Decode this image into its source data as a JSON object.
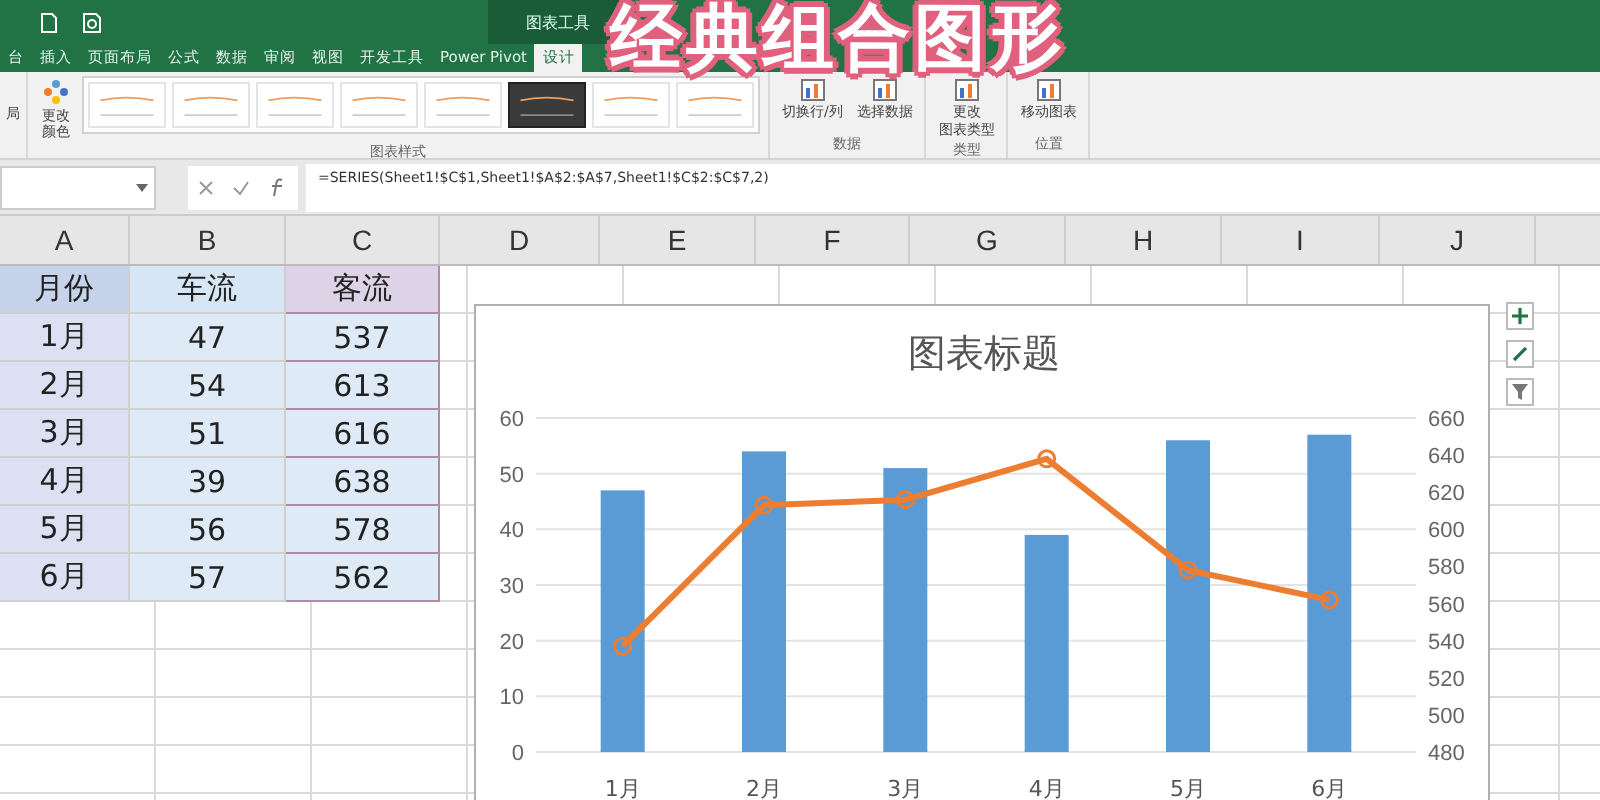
{
  "title_bar": {
    "context_label": "图表工具"
  },
  "overlay_caption": "经典组合图形",
  "tabs": [
    {
      "label": "台",
      "selected": false
    },
    {
      "label": "插入",
      "selected": false
    },
    {
      "label": "页面布局",
      "selected": false
    },
    {
      "label": "公式",
      "selected": false
    },
    {
      "label": "数据",
      "selected": false
    },
    {
      "label": "审阅",
      "selected": false
    },
    {
      "label": "视图",
      "selected": false
    },
    {
      "label": "开发工具",
      "selected": false
    },
    {
      "label": "Power Pivot",
      "selected": false
    },
    {
      "label": "设计",
      "selected": true
    }
  ],
  "ribbon": {
    "partial_label": "局",
    "change_colors": "更改颜色",
    "styles": [
      {
        "selected": false
      },
      {
        "selected": false
      },
      {
        "selected": false
      },
      {
        "selected": false
      },
      {
        "selected": false
      },
      {
        "selected": true
      },
      {
        "selected": false
      },
      {
        "selected": false
      }
    ],
    "styles_group": "图表样式",
    "groups": [
      {
        "label": "数据",
        "buttons": [
          {
            "lines": [
              "切换行/列"
            ]
          },
          {
            "lines": [
              "选择数据"
            ]
          }
        ]
      },
      {
        "label": "类型",
        "buttons": [
          {
            "lines": [
              "更改",
              "图表类型"
            ]
          }
        ]
      },
      {
        "label": "位置",
        "buttons": [
          {
            "lines": [
              "移动图表"
            ]
          }
        ]
      }
    ]
  },
  "formula_bar": {
    "formula": "=SERIES(Sheet1!$C$1,Sheet1!$A$2:$A$7,Sheet1!$C$2:$C$7,2)"
  },
  "columns": [
    "A",
    "B",
    "C",
    "D",
    "E",
    "F",
    "G",
    "H",
    "I",
    "J"
  ],
  "rows": [
    [
      "月份",
      "车流",
      "客流"
    ],
    [
      "1月",
      "47",
      "537"
    ],
    [
      "2月",
      "54",
      "613"
    ],
    [
      "3月",
      "51",
      "616"
    ],
    [
      "4月",
      "39",
      "638"
    ],
    [
      "5月",
      "56",
      "578"
    ],
    [
      "6月",
      "57",
      "562"
    ]
  ],
  "chart": {
    "chart_data": {
      "type": "bar",
      "title": "图表标题",
      "categories": [
        "1月",
        "2月",
        "3月",
        "4月",
        "5月",
        "6月"
      ],
      "grid": true,
      "series": [
        {
          "color": "#5b9bd5",
          "values": [
            47,
            54,
            51,
            39,
            56,
            57
          ]
        },
        {
          "type": "line",
          "axis": "y2",
          "marker": "o",
          "color": "#ed7d31",
          "values": [
            537,
            613,
            616,
            638,
            578,
            562
          ]
        }
      ],
      "ylim": [
        0,
        60
      ],
      "yticks": [
        0,
        10,
        20,
        30,
        40,
        50,
        60
      ],
      "y2lim": [
        480,
        660
      ],
      "y2ticks": [
        480,
        500,
        520,
        540,
        560,
        580,
        600,
        620,
        640,
        660
      ]
    }
  }
}
